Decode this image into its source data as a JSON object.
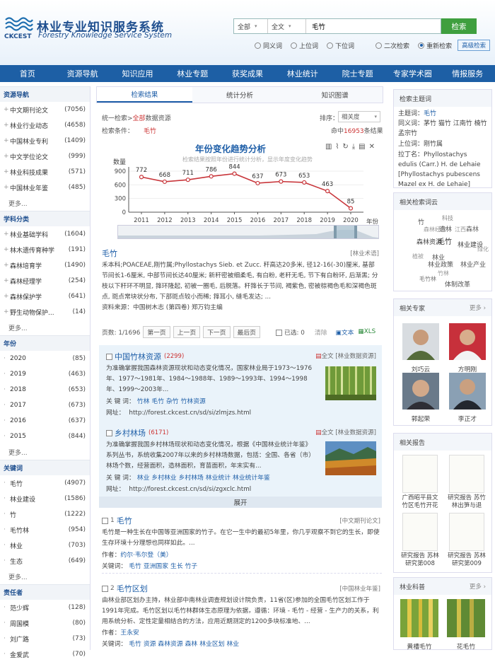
{
  "header": {
    "title_cn": "林业专业知识服务系统",
    "title_en": "Forestry Knowledge Service System",
    "logo_text": "CKCEST"
  },
  "search": {
    "scope": "全部",
    "field": "全文",
    "query": "毛竹",
    "button": "检索",
    "options": [
      "同义词",
      "上位词",
      "下位词"
    ],
    "mode_options": [
      "二次检索",
      "重新检索"
    ],
    "mode_selected": 1,
    "advanced": "高级检索"
  },
  "nav": [
    "首页",
    "资源导航",
    "知识应用",
    "林业专题",
    "获奖成果",
    "林业统计",
    "院士专题",
    "专家学术圈",
    "情报服务"
  ],
  "left": {
    "sections": [
      {
        "title": "资源导航",
        "items": [
          [
            "中文期刊论文",
            "(7056)"
          ],
          [
            "林业行业动态",
            "(4658)"
          ],
          [
            "中国林业专利",
            "(1409)"
          ],
          [
            "中文学位论文",
            "(999)"
          ],
          [
            "林业科技成果",
            "(571)"
          ],
          [
            "中国林业年鉴",
            "(485)"
          ]
        ],
        "prefix": "+"
      },
      {
        "title": "学科分类",
        "items": [
          [
            "林业基础学科",
            "(1604)"
          ],
          [
            "林木遗传育种学",
            "(191)"
          ],
          [
            "森林培育学",
            "(1490)"
          ],
          [
            "森林经理学",
            "(254)"
          ],
          [
            "森林保护学",
            "(641)"
          ],
          [
            "野生动物保护...",
            "(14)"
          ]
        ],
        "prefix": "+"
      },
      {
        "title": "年份",
        "items": [
          [
            "2020",
            "(85)"
          ],
          [
            "2019",
            "(463)"
          ],
          [
            "2018",
            "(653)"
          ],
          [
            "2017",
            "(673)"
          ],
          [
            "2016",
            "(637)"
          ],
          [
            "2015",
            "(844)"
          ]
        ],
        "prefix": "·"
      },
      {
        "title": "关键词",
        "items": [
          [
            "毛竹",
            "(4907)"
          ],
          [
            "林业建设",
            "(1586)"
          ],
          [
            "竹",
            "(1222)"
          ],
          [
            "毛竹林",
            "(954)"
          ],
          [
            "林业",
            "(703)"
          ],
          [
            "生态",
            "(649)"
          ]
        ],
        "prefix": "·"
      },
      {
        "title": "责任者",
        "items": [
          [
            "范少辉",
            "(128)"
          ],
          [
            "周国模",
            "(80)"
          ],
          [
            "刘广路",
            "(73)"
          ],
          [
            "金爱武",
            "(70)"
          ]
        ],
        "prefix": "·"
      }
    ],
    "more": "更多..."
  },
  "center": {
    "tabs": [
      "检索结果",
      "统计分析",
      "知识图谱"
    ],
    "crumb_prefix": "统一检索>",
    "crumb_red": "全部",
    "crumb_suffix": "数据资源",
    "cond_label": "检索条件：",
    "cond_value": "毛竹",
    "sort_label": "排序：",
    "sort_value": "相关度",
    "hits_prefix": "命中",
    "hits_value": "16953",
    "hits_suffix": "条结果",
    "chart_title": "年份变化趋势分析",
    "chart_sub": "检索结果按照年份进行统计分析，显示年度变化趋势",
    "definition": {
      "title": "毛竹",
      "source": "[林业术语]",
      "body": "禾本科;POACEAE,刚竹属;Phyllostachys Sieb. et Zucc. 秆高达20多米, 径12-16(-30)厘米, 基部节间长1-6厘米, 中部节间长达40厘米; 新秆密被细柔毛, 有白粉, 老秆无毛, 节下有白粉环, 后渐黑; 分枝以下秆环不明显, 箨环隆起, 初被一圈毛, 后脱落。秆箨长于节间, 褐紫色, 密被棕褐色毛和深褐色斑点, 斑点常块状分布, 下部斑点较小而稀; 箨耳小, 缝毛发达; ...",
      "ref_label": "资料来源：",
      "ref": "中国树木志 (第四卷) 郑万钧主编"
    },
    "pager": {
      "info": "页数: 1/1696",
      "first": "第一页",
      "prev": "上一页",
      "next": "下一页",
      "last": "最后页",
      "selected": "已选: 0",
      "clear": "清除",
      "text": "文本",
      "xls": "XLS"
    },
    "resources": [
      {
        "title": "中国竹林资源",
        "count": "(2299)",
        "fulltext": "全文",
        "tag": "[林业数据资源]",
        "desc": "为准确掌握我国森林资源现状和动态变化情况，国家林业局于1973～1976年、1977～1981年、1984～1988年、1989～1993年、1994～1998年、1999～2003年...",
        "kw_label": "关 键 词：",
        "keywords": [
          "竹林",
          "毛竹",
          "杂竹",
          "竹林资源"
        ],
        "url_label": "网址：",
        "url": "http://forest.ckcest.cn/sd/si/zlmjzs.html"
      },
      {
        "title": "乡村林场",
        "count": "(6171)",
        "fulltext": "全文",
        "tag": "[林业数据资源]",
        "desc": "为准确掌握我国乡村林场现状和动态变化情况，根据《中国林业统计年鉴》系列丛书，系统收集2007年以来的乡村林场数据，包括：全国、各省（市）林场个数，经营面积，造林面积，育苗面积，年末实有...",
        "kw_label": "关 键 词：",
        "keywords": [
          "林业",
          "乡村林业",
          "乡村林场",
          "林业统计",
          "林业统计年鉴"
        ],
        "url_label": "网址：",
        "url": "http://forest.ckcest.cn/sd/si/zgxclc.html"
      }
    ],
    "expand": "展开",
    "articles": [
      {
        "idx": "1",
        "title": "毛竹",
        "source": "[中文期刊论文]",
        "body": "毛竹是一种生长在中国等亚洲国家的竹子。在它一生中的最初5年里，你几乎观察不到它的生长，即使生存环境十分理想也同样如此。...",
        "auth_label": "作者：",
        "author": "约尔·韦尔登（美）",
        "kw_label": "关键词：",
        "keywords": [
          "毛竹",
          "亚洲国家",
          "生长",
          "竹子"
        ]
      },
      {
        "idx": "2",
        "title": "毛竹区划",
        "source": "[中国林业年鉴]",
        "body": "由林业部区划办主持，林业部中南林业调查规划设计院负责，11省(区)参加的全国毛竹区划工作于1991年完成。毛竹区划以毛竹林群体生态原理为依据，遵循：环境 - 毛竹 - 经营 - 生产力的关系，利用系统分析、定性定量相结合的方法，应用近期测定的1200多块标准地、...",
        "auth_label": "作者：",
        "author": "王永安",
        "kw_label": "关键词：",
        "keywords": [
          "毛竹",
          "资源",
          "森林资源",
          "森林",
          "林业区划",
          "林业"
        ]
      }
    ]
  },
  "chart_data": {
    "type": "line",
    "x": [
      "2011",
      "2012",
      "2013",
      "2014",
      "2015",
      "2016",
      "2017",
      "2018",
      "2019",
      "2020"
    ],
    "values": [
      772,
      668,
      711,
      786,
      844,
      637,
      673,
      653,
      463,
      85
    ],
    "ylabel": "数量",
    "xlabel": "年份",
    "ylim": [
      0,
      900
    ],
    "yticks": [
      0,
      300,
      600,
      900
    ],
    "color": "#c8353a"
  },
  "right": {
    "topic": {
      "title": "检索主题词",
      "main_label": "主题词：",
      "main": "毛竹",
      "syn_label": "同义词：",
      "syn": "茅竹 猫竹 江南竹 楠竹 孟宗竹",
      "upper_label": "上位词：",
      "upper": "刚竹属",
      "latin_label": "拉丁名：",
      "latin": "Phyllostachys edulis (Carr.) H. de Lehaie [Phyllostachys pubescens Mazel ex H. de Lehaie]"
    },
    "cloud_title": "相关检索词云",
    "cloud": [
      "竹",
      "科技",
      "森林经营",
      "造林",
      "江西",
      "森林",
      "森林资源",
      "林业建设",
      "林业",
      "毛竹",
      "林业政策",
      "绿化",
      "植被",
      "林业产业",
      "竹林",
      "毛竹林",
      "体制改革"
    ],
    "experts_title": "相关专家",
    "more": "更多 ›",
    "experts": [
      "刘巧云",
      "方明刚",
      "郭起荣",
      "李正才"
    ],
    "reports_title": "相关报告",
    "reports": [
      "广西昭平县文竹区毛竹开花",
      "研究报告 苏竹林出笋与退",
      "研究报告 苏林研究第008",
      "研究报告 苏林研究第009"
    ],
    "science_title": "林业科普",
    "science": [
      "黄槽毛竹",
      "花毛竹"
    ]
  }
}
